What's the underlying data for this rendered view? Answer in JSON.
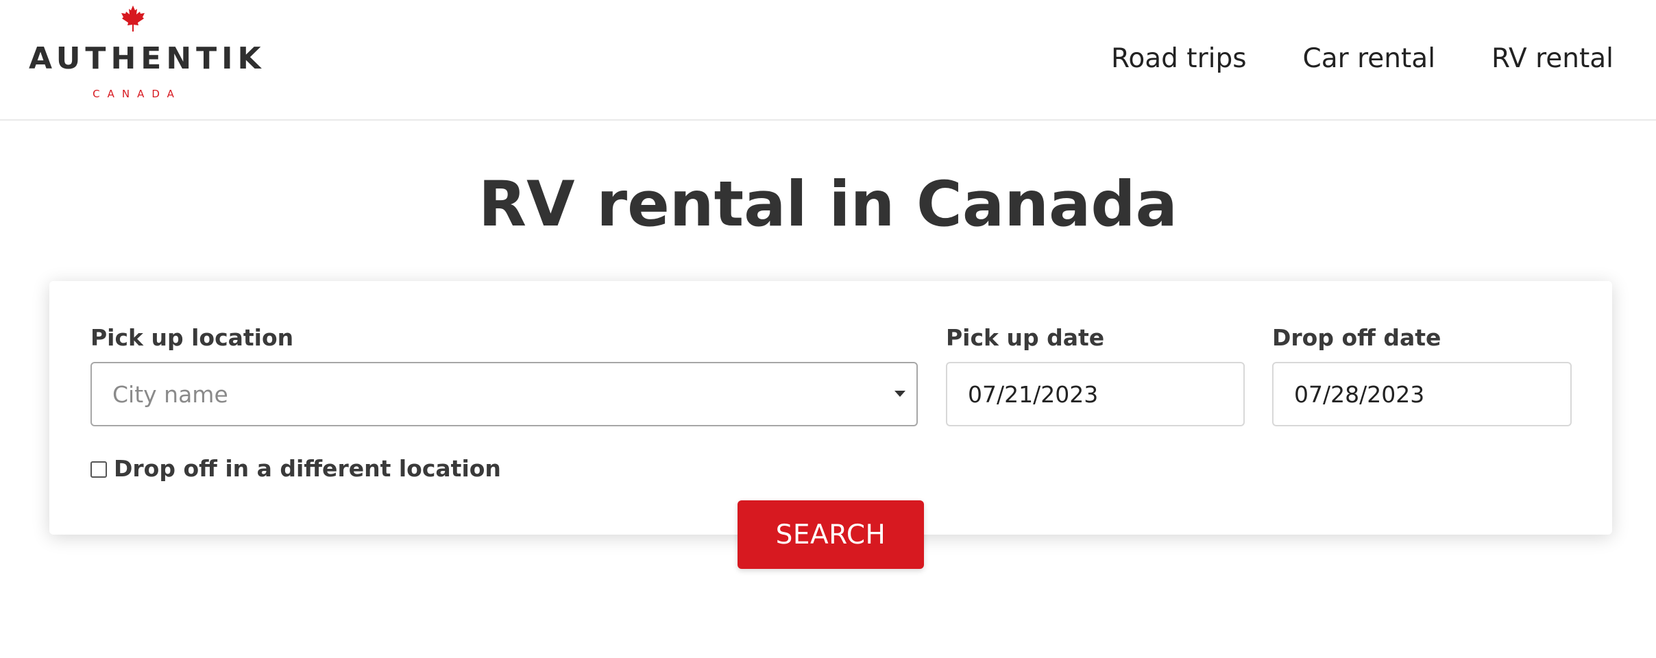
{
  "brand": {
    "name": "AUTHENTIK",
    "subtitle": "CANADA",
    "leaf_color": "#d71920",
    "icon": "maple-leaf-icon"
  },
  "nav": {
    "items": [
      {
        "label": "Road trips"
      },
      {
        "label": "Car rental"
      },
      {
        "label": "RV rental"
      }
    ]
  },
  "page": {
    "title": "RV rental in Canada"
  },
  "search_form": {
    "pickup_location": {
      "label": "Pick up location",
      "placeholder": "City name",
      "value": ""
    },
    "pickup_date": {
      "label": "Pick up date",
      "value": "07/21/2023"
    },
    "dropoff_date": {
      "label": "Drop off date",
      "value": "07/28/2023"
    },
    "different_location": {
      "label": "Drop off in a different location",
      "checked": false
    },
    "submit_label": "SEARCH",
    "accent_color": "#d71920"
  }
}
